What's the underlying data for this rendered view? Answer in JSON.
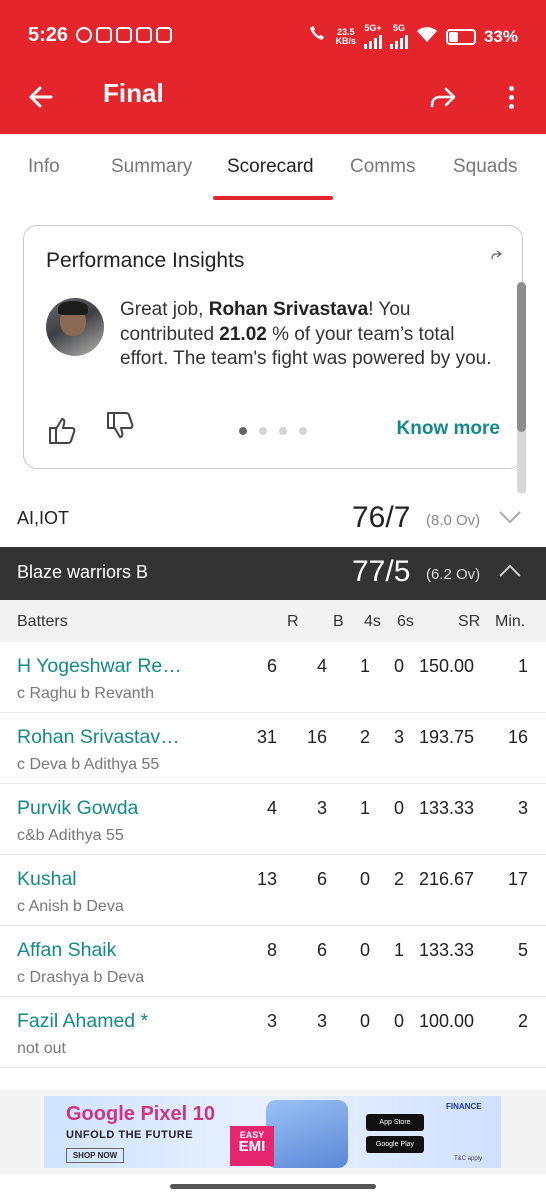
{
  "status_bar": {
    "time": "5:26",
    "network_speed": "23.5",
    "network_unit": "KB/s",
    "signal_1": "5G+",
    "signal_2": "5G",
    "battery": "33%"
  },
  "app_bar": {
    "title": "Final"
  },
  "tabs": [
    {
      "label": "Info",
      "active": false
    },
    {
      "label": "Summary",
      "active": false
    },
    {
      "label": "Scorecard",
      "active": true
    },
    {
      "label": "Comms",
      "active": false
    },
    {
      "label": "Squads",
      "active": false
    }
  ],
  "insights": {
    "title": "Performance Insights",
    "text_1": "Great job, ",
    "player": "Rohan Srivastava",
    "text_2": "! You contributed ",
    "percent": "21.02",
    "text_3": " % of your team’s total effort. The team's fight was powered by you.",
    "know_more": "Know more",
    "pages": 4,
    "current_page": 1
  },
  "innings": [
    {
      "team": "AI,IOT",
      "score": "76/7",
      "overs": "(8.0 Ov)",
      "expanded": false
    },
    {
      "team": "Blaze warriors B",
      "score": "77/5",
      "overs": "(6.2 Ov)",
      "expanded": true
    }
  ],
  "batting_headers": {
    "name": "Batters",
    "r": "R",
    "b": "B",
    "fours": "4s",
    "sixes": "6s",
    "sr": "SR",
    "min": "Min."
  },
  "batters": [
    {
      "name": "H Yogeshwar Re…",
      "dismissal": "c Raghu b Revanth",
      "r": "6",
      "b": "4",
      "fours": "1",
      "sixes": "0",
      "sr": "150.00",
      "min": "1"
    },
    {
      "name": "Rohan Srivastav…",
      "dismissal": "c Deva b Adithya 55",
      "r": "31",
      "b": "16",
      "fours": "2",
      "sixes": "3",
      "sr": "193.75",
      "min": "16"
    },
    {
      "name": "Purvik Gowda",
      "dismissal": "c&b Adithya 55",
      "r": "4",
      "b": "3",
      "fours": "1",
      "sixes": "0",
      "sr": "133.33",
      "min": "3"
    },
    {
      "name": "Kushal",
      "dismissal": "c Anish b Deva",
      "r": "13",
      "b": "6",
      "fours": "0",
      "sixes": "2",
      "sr": "216.67",
      "min": "17"
    },
    {
      "name": "Affan Shaik",
      "dismissal": "c Drashya b Deva",
      "r": "8",
      "b": "6",
      "fours": "0",
      "sixes": "1",
      "sr": "133.33",
      "min": "5"
    },
    {
      "name": "Fazil Ahamed *",
      "dismissal": "not out",
      "r": "3",
      "b": "3",
      "fours": "0",
      "sixes": "0",
      "sr": "100.00",
      "min": "2"
    }
  ],
  "ad": {
    "title": "Google Pixel 10",
    "subtitle": "UNFOLD THE FUTURE",
    "cta": "SHOP NOW",
    "badge_1": "EASY",
    "badge_2": "EMI",
    "store_1": "App Store",
    "store_2": "Google Play",
    "bank": "FINANCE",
    "tc": "T&C apply"
  },
  "colors": {
    "brand": "#e5252c",
    "link": "#138a8a",
    "dark_row": "#333333"
  }
}
